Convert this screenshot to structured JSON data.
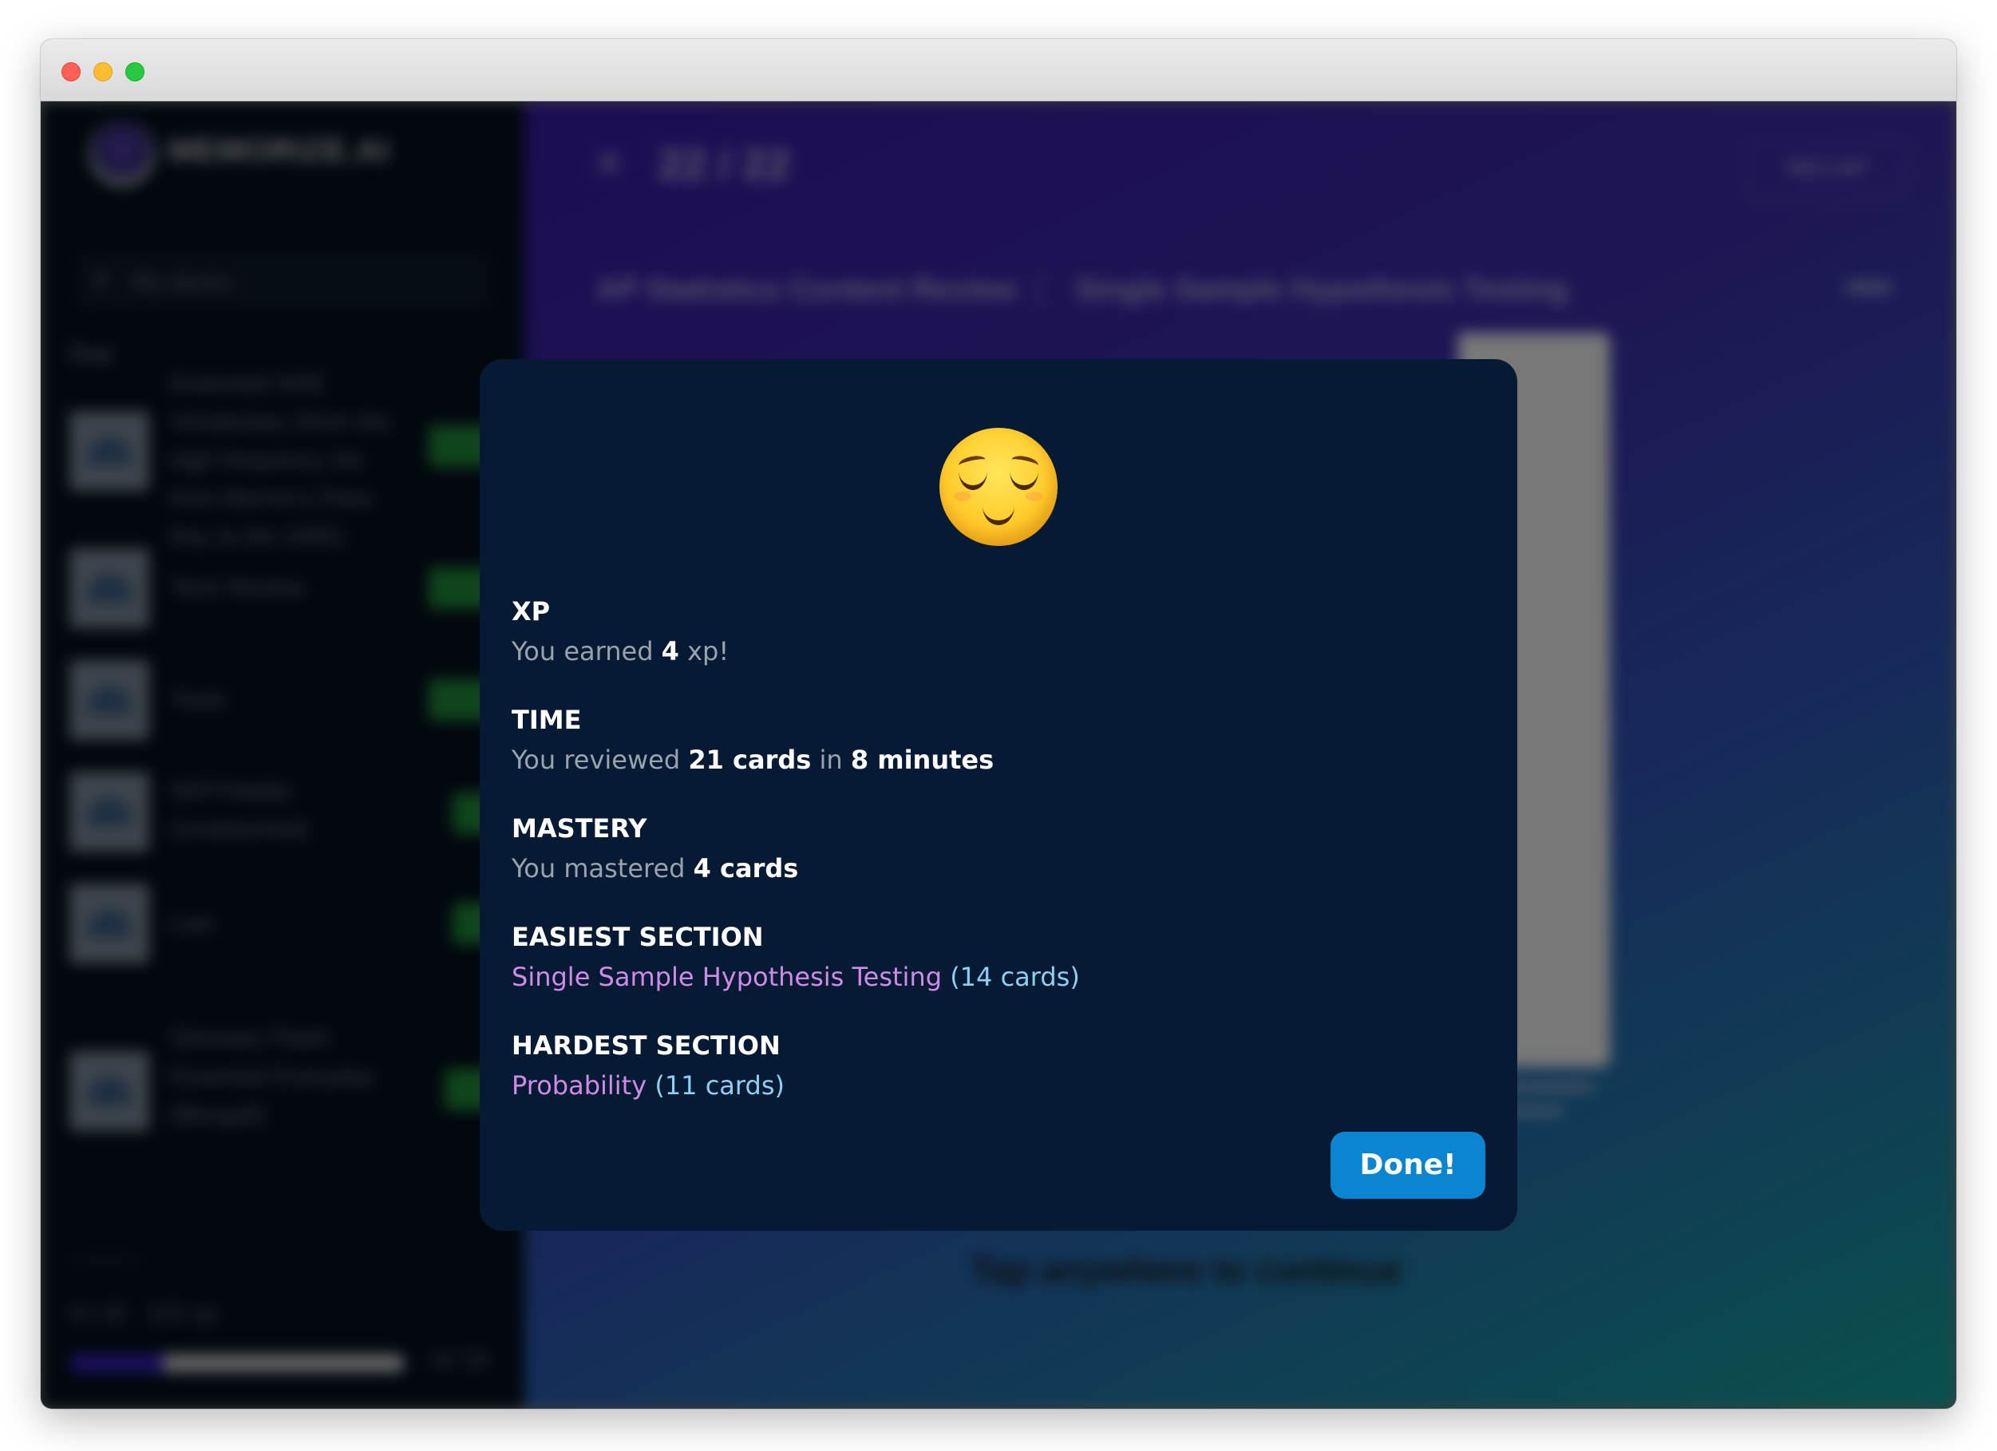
{
  "background_app": {
    "brand_name": "MEMORIZE.AI",
    "search_placeholder": "My decks",
    "sidebar_section": "Due",
    "decks": [
      {
        "title": "Essential GRE Vocabulary (from the high frequency list from Barron's Pass Key to the GRE)",
        "badge": "120"
      },
      {
        "title": "Tech Review",
        "badge": "120"
      },
      {
        "title": "Tools",
        "badge": "120"
      },
      {
        "title": "SAT/Vitality (Unattached)",
        "badge": "60"
      },
      {
        "title": "Law",
        "badge": "60"
      },
      {
        "title": "Glossary Flash Essential Everyday (Bengali)",
        "badge": "80"
      }
    ],
    "level_label": "lvl 18 · 115 xp",
    "level_next": "lvl 19",
    "level_progress": 0.28,
    "progress_count": "22 / 22",
    "recap_label": "RECAP",
    "breadcrumb_deck": "AP Statistics Content Review",
    "breadcrumb_section": "Single Sample Hypothesis Testing",
    "tap_hint": "Tap anywhere to continue"
  },
  "modal": {
    "emoji_name": "relieved-face-icon",
    "stats": {
      "xp": {
        "title": "XP",
        "prefix": "You earned",
        "value": "4",
        "suffix": "xp!"
      },
      "time": {
        "title": "TIME",
        "prefix": "You reviewed",
        "cards": "21 cards",
        "middle": "in",
        "minutes": "8 minutes"
      },
      "mastery": {
        "title": "MASTERY",
        "prefix": "You mastered",
        "value": "4 cards"
      },
      "easiest": {
        "title": "EASIEST SECTION",
        "section": "Single Sample Hypothesis Testing",
        "count": "(14 cards)"
      },
      "hardest": {
        "title": "HARDEST SECTION",
        "section": "Probability",
        "count": "(11 cards)"
      }
    },
    "done_label": "Done!"
  },
  "colors": {
    "modal_bg": "#061b33",
    "accent_button": "#0a85d1",
    "section_name": "#cf8be6",
    "section_count": "#8ed0f3",
    "muted_text": "#9aa3ad"
  }
}
